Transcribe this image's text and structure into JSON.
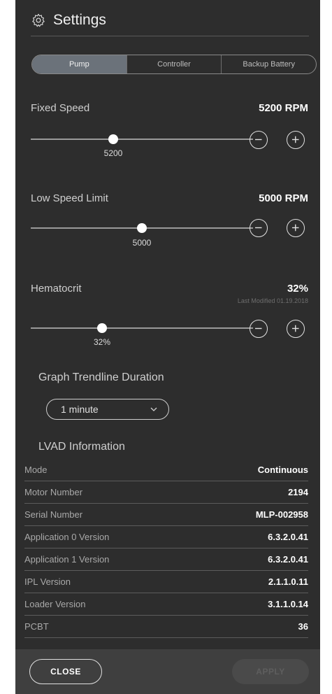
{
  "header": {
    "title": "Settings",
    "icon": "gear-icon"
  },
  "tabs": [
    {
      "label": "Pump",
      "active": true
    },
    {
      "label": "Controller",
      "active": false
    },
    {
      "label": "Backup Battery",
      "active": false
    }
  ],
  "fixed_speed": {
    "label": "Fixed Speed",
    "value": "5200 RPM",
    "slider_value": "5200",
    "slider_fraction": 0.37
  },
  "low_speed_limit": {
    "label": "Low Speed Limit",
    "value": "5000 RPM",
    "slider_value": "5000",
    "slider_fraction": 0.5
  },
  "hematocrit": {
    "label": "Hematocrit",
    "value": "32%",
    "last_modified": "Last Modified 01.19.2018",
    "slider_value": "32%",
    "slider_fraction": 0.32
  },
  "trendline": {
    "title": "Graph Trendline Duration",
    "selected": "1 minute"
  },
  "lvad": {
    "title": "LVAD Information",
    "rows": [
      {
        "key": "Mode",
        "value": "Continuous"
      },
      {
        "key": "Motor Number",
        "value": "2194"
      },
      {
        "key": "Serial Number",
        "value": "MLP-002958"
      },
      {
        "key": "Application 0 Version",
        "value": "6.3.2.0.41"
      },
      {
        "key": "Application 1 Version",
        "value": "6.3.2.0.41"
      },
      {
        "key": "IPL Version",
        "value": "2.1.1.0.11"
      },
      {
        "key": "Loader Version",
        "value": "3.1.1.0.14"
      },
      {
        "key": "PCBT",
        "value": "36"
      }
    ]
  },
  "footer": {
    "close_label": "CLOSE",
    "apply_label": "APPLY"
  },
  "colors": {
    "panel": "#2d2d2d",
    "active_tab": "#6b727a",
    "footer": "#3f3f3f"
  }
}
